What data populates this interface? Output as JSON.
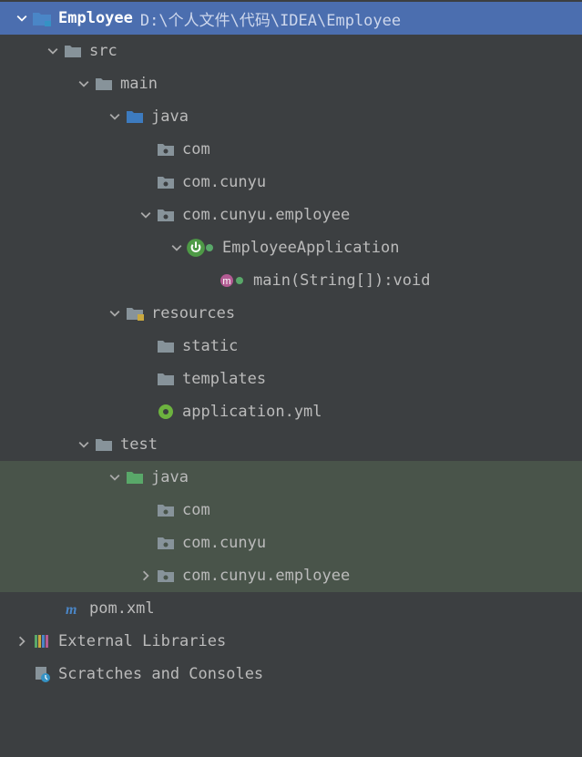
{
  "tree": {
    "root": {
      "name": "Employee",
      "path": "D:\\个人文件\\代码\\IDEA\\Employee"
    },
    "src": "src",
    "main": "main",
    "java_main": "java",
    "pkg_com": "com",
    "pkg_com_cunyu": "com.cunyu",
    "pkg_com_cunyu_employee": "com.cunyu.employee",
    "class_employee_app": "EmployeeApplication",
    "method_main": "main(String[]):void",
    "resources": "resources",
    "static_dir": "static",
    "templates_dir": "templates",
    "app_yml": "application.yml",
    "test": "test",
    "java_test": "java",
    "test_pkg_com": "com",
    "test_pkg_com_cunyu": "com.cunyu",
    "test_pkg_com_cunyu_employee": "com.cunyu.employee",
    "pom": "pom.xml",
    "ext_lib": "External Libraries",
    "scratches": "Scratches and Consoles"
  }
}
